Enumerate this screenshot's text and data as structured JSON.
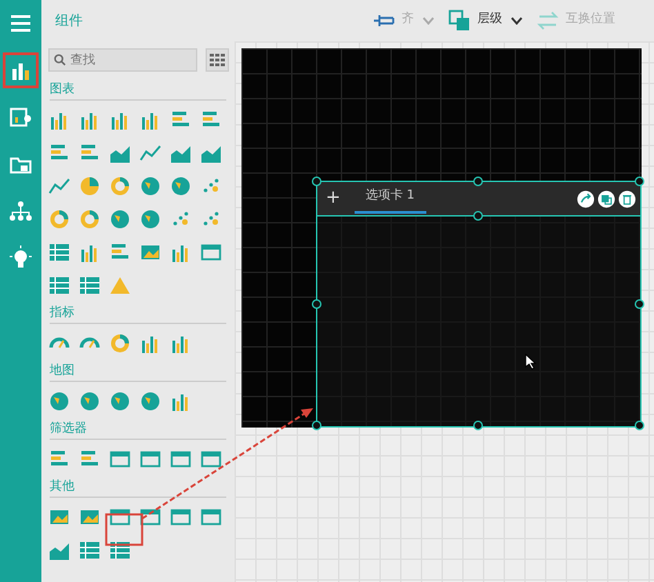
{
  "rail": {
    "items": [
      {
        "kind": "menu",
        "selected": false
      },
      {
        "kind": "chart",
        "selected": true
      },
      {
        "kind": "data",
        "selected": false
      },
      {
        "kind": "folder",
        "selected": false
      },
      {
        "kind": "tree",
        "selected": false
      },
      {
        "kind": "bulb",
        "selected": false
      }
    ]
  },
  "panel": {
    "title": "组件",
    "search": {
      "placeholder": "查找"
    },
    "sections": [
      {
        "title": "图表"
      },
      {
        "title": "指标"
      },
      {
        "title": "地图"
      },
      {
        "title": "筛选器"
      },
      {
        "title": "其他"
      }
    ]
  },
  "toolbar": [
    {
      "kind": "pin"
    },
    {
      "kind": "text",
      "label": "齐",
      "disabled": true
    },
    {
      "kind": "caret",
      "disabled": true
    },
    {
      "kind": "layers"
    },
    {
      "kind": "text",
      "label": "层级",
      "disabled": false
    },
    {
      "kind": "caret",
      "disabled": false
    },
    {
      "kind": "swap"
    },
    {
      "kind": "text",
      "label": "互换位置",
      "disabled": true
    }
  ],
  "widget": {
    "tabs": [
      {
        "label": "选项卡 1",
        "selected": true
      }
    ],
    "add_label": "+"
  }
}
